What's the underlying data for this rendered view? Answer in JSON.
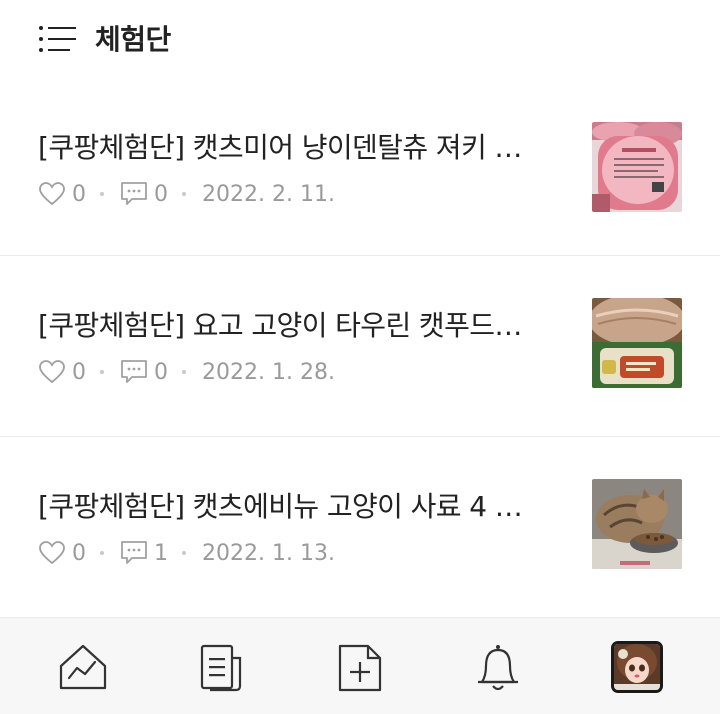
{
  "header": {
    "title": "체험단",
    "menu_icon": "list-menu-icon"
  },
  "posts": [
    {
      "title": "[쿠팡체험단] 캣츠미어 냥이덴탈츄 져키 …",
      "likes": "0",
      "comments": "0",
      "date": "2022. 2. 11.",
      "thumbnail": "pink-cat-treat-cans"
    },
    {
      "title": "[쿠팡체험단] 요고 고양이 타우린 캣푸드…",
      "likes": "0",
      "comments": "0",
      "date": "2022. 1. 28.",
      "thumbnail": "cat-food-can"
    },
    {
      "title": "[쿠팡체험단] 캣츠에비뉴 고양이 사료 4 …",
      "likes": "0",
      "comments": "1",
      "date": "2022. 1. 13.",
      "thumbnail": "cat-eating-from-bowl"
    }
  ],
  "bottom_nav": {
    "items": [
      "stats-home-icon",
      "posts-icon",
      "new-post-icon",
      "notification-bell-icon",
      "profile-avatar"
    ]
  },
  "colors": {
    "text": "#222222",
    "meta": "#9a9a9a",
    "divider": "#ececec",
    "nav_bg": "#f7f7f7"
  }
}
